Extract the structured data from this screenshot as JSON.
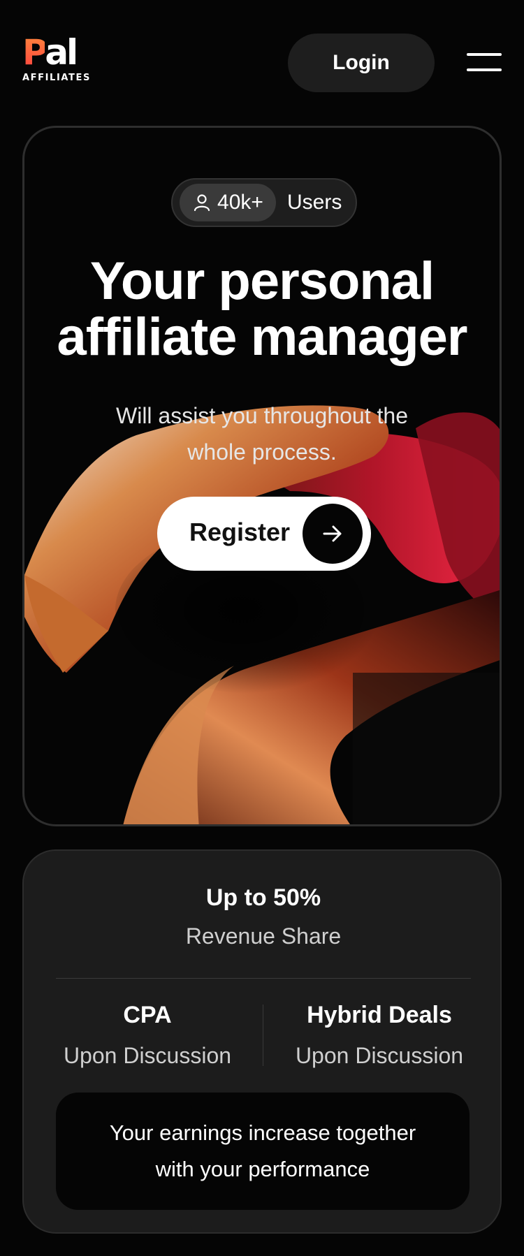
{
  "header": {
    "logo_word_p": "P",
    "logo_word_rest": "al",
    "logo_sub": "AFFILIATES",
    "login_label": "Login",
    "menu_icon": "hamburger-menu-icon"
  },
  "hero": {
    "badge_icon": "user-icon",
    "badge_count": "40k+",
    "badge_label": "Users",
    "title_line1": "Your personal",
    "title_line2": "affiliate manager",
    "subtitle": "Will assist you throughout the whole process.",
    "register_label": "Register",
    "register_icon": "arrow-right-icon"
  },
  "stats": {
    "revenue_title": "Up to 50%",
    "revenue_sub": "Revenue Share",
    "cpa_title": "CPA",
    "cpa_sub": "Upon Discussion",
    "hybrid_title": "Hybrid Deals",
    "hybrid_sub": "Upon Discussion",
    "earnings_text": "Your earnings increase together with your performance"
  },
  "colors": {
    "background": "#050505",
    "card": "#1c1c1c",
    "accent_orange": "#ff6a2a",
    "accent_red": "#c4132a"
  }
}
